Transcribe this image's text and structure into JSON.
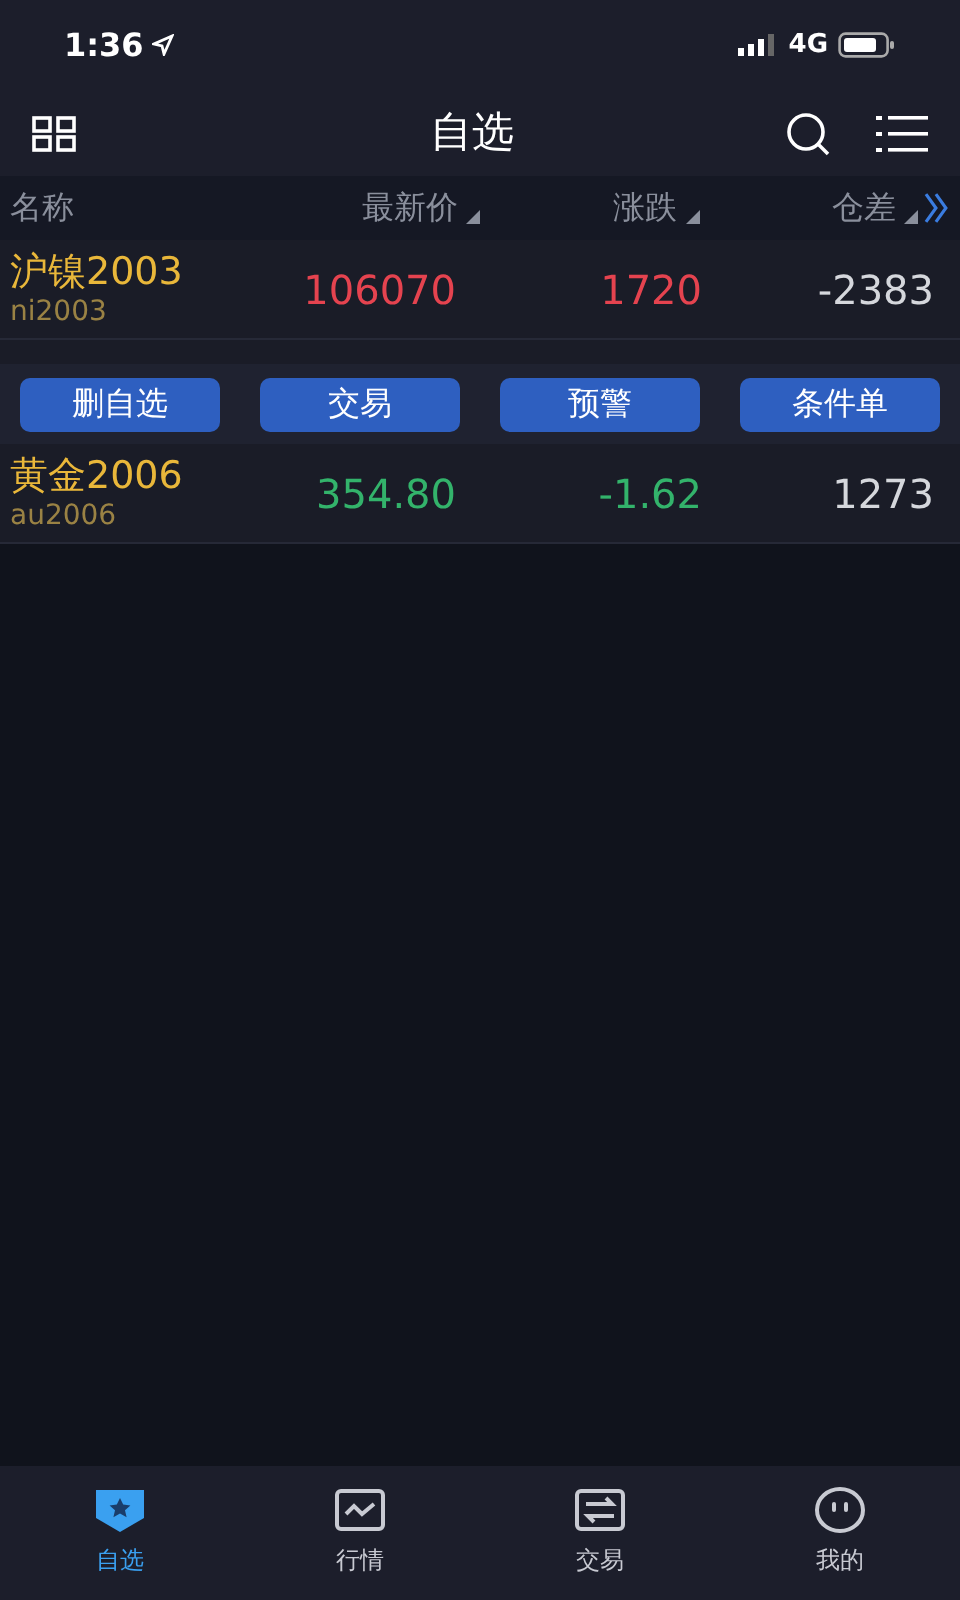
{
  "status_bar": {
    "time": "1:36",
    "network": "4G"
  },
  "header": {
    "title": "自选"
  },
  "table": {
    "columns": [
      {
        "label": "名称",
        "sortable": false
      },
      {
        "label": "最新价",
        "sortable": true
      },
      {
        "label": "涨跌",
        "sortable": true
      },
      {
        "label": "仓差",
        "sortable": true
      }
    ],
    "rows": [
      {
        "kind": "quote",
        "name": "沪镍2003",
        "code": "ni2003",
        "price": "106070",
        "change": "1720",
        "oi_change": "-2383",
        "color": "#e5434f"
      },
      {
        "kind": "hidden"
      },
      {
        "kind": "quote",
        "name": "黄金2006",
        "code": "au2006",
        "price": "354.80",
        "change": "-1.62",
        "oi_change": "1273",
        "color": "#33b36b"
      }
    ]
  },
  "row_menu": {
    "buttons": [
      "删自选",
      "交易",
      "预警",
      "条件单"
    ]
  },
  "tab_bar": [
    {
      "label": "自选",
      "selected": true,
      "kind": "watchlist"
    },
    {
      "label": "行情",
      "selected": false,
      "kind": "chart"
    },
    {
      "label": "交易",
      "selected": false,
      "kind": "trade"
    },
    {
      "label": "我的",
      "selected": false,
      "kind": "face"
    }
  ]
}
